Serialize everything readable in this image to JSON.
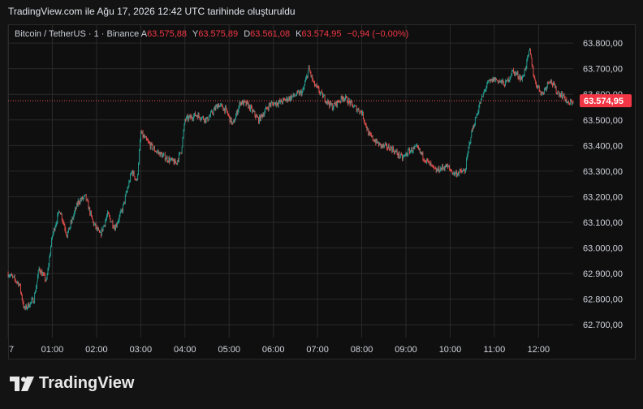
{
  "header": {
    "title": "TradingView.com ile Ağu 17, 2026 12:42 UTC tarihinde oluşturuldu"
  },
  "legend": {
    "symbol": "Bitcoin / TetherUS · 1 · Binance",
    "open_label": "A",
    "open": "63.575,88",
    "high_label": "Y",
    "high": "63.575,89",
    "low_label": "D",
    "low": "63.561,08",
    "close_label": "K",
    "close": "63.574,95",
    "change": "−0,94 (−0,00%)"
  },
  "brand": {
    "name": "TradingView",
    "icon": "tradingview-logo-icon"
  },
  "colors": {
    "up": "#26a69a",
    "down": "#ef5350",
    "grid": "#2a2a2a",
    "price_line": "#ef5350",
    "price_badge": "#f23645",
    "text": "#d1d4dc"
  },
  "chart_data": {
    "type": "candlestick",
    "x_unit": "time (UTC, 2026-08-17)",
    "x_range": [
      "00:00",
      "12:47"
    ],
    "y_range": [
      62650,
      63870
    ],
    "y_ticks": [
      63800,
      63700,
      63600,
      63500,
      63400,
      63300,
      63200,
      63100,
      63000,
      62900,
      62800,
      62700
    ],
    "y_tick_labels": [
      "63.800,00",
      "63.700,00",
      "63.600,00",
      "63.500,00",
      "63.400,00",
      "63.300,00",
      "63.200,00",
      "63.100,00",
      "63.000,00",
      "62.900,00",
      "62.800,00",
      "62.700,00"
    ],
    "x_ticks": [
      "00:00",
      "01:00",
      "02:00",
      "03:00",
      "04:00",
      "05:00",
      "06:00",
      "07:00",
      "08:00",
      "09:00",
      "10:00",
      "11:00",
      "12:00"
    ],
    "x_tick_labels": [
      "7",
      "01:00",
      "02:00",
      "03:00",
      "04:00",
      "05:00",
      "06:00",
      "07:00",
      "08:00",
      "09:00",
      "10:00",
      "11:00",
      "12:00"
    ],
    "last_price": 63574.95,
    "last_price_label": "63.574,95",
    "grid": true,
    "price_path": [
      [
        "00:00",
        62900
      ],
      [
        "00:15",
        62860
      ],
      [
        "00:22",
        62760
      ],
      [
        "00:35",
        62800
      ],
      [
        "00:42",
        62920
      ],
      [
        "00:52",
        62870
      ],
      [
        "01:00",
        63050
      ],
      [
        "01:10",
        63150
      ],
      [
        "01:20",
        63050
      ],
      [
        "01:35",
        63180
      ],
      [
        "01:45",
        63200
      ],
      [
        "01:55",
        63100
      ],
      [
        "02:05",
        63050
      ],
      [
        "02:15",
        63130
      ],
      [
        "02:25",
        63080
      ],
      [
        "02:35",
        63150
      ],
      [
        "02:48",
        63300
      ],
      [
        "02:55",
        63260
      ],
      [
        "03:00",
        63450
      ],
      [
        "03:10",
        63410
      ],
      [
        "03:20",
        63380
      ],
      [
        "03:35",
        63350
      ],
      [
        "03:48",
        63330
      ],
      [
        "03:55",
        63380
      ],
      [
        "04:00",
        63500
      ],
      [
        "04:15",
        63520
      ],
      [
        "04:30",
        63500
      ],
      [
        "04:45",
        63560
      ],
      [
        "04:55",
        63540
      ],
      [
        "05:05",
        63480
      ],
      [
        "05:15",
        63570
      ],
      [
        "05:25",
        63560
      ],
      [
        "05:40",
        63500
      ],
      [
        "05:55",
        63560
      ],
      [
        "06:10",
        63570
      ],
      [
        "06:25",
        63590
      ],
      [
        "06:40",
        63610
      ],
      [
        "06:48",
        63700
      ],
      [
        "06:55",
        63640
      ],
      [
        "07:05",
        63600
      ],
      [
        "07:20",
        63550
      ],
      [
        "07:35",
        63590
      ],
      [
        "07:50",
        63550
      ],
      [
        "08:00",
        63530
      ],
      [
        "08:10",
        63440
      ],
      [
        "08:25",
        63400
      ],
      [
        "08:40",
        63390
      ],
      [
        "08:55",
        63350
      ],
      [
        "09:05",
        63380
      ],
      [
        "09:15",
        63390
      ],
      [
        "09:25",
        63350
      ],
      [
        "09:40",
        63300
      ],
      [
        "09:55",
        63320
      ],
      [
        "10:05",
        63290
      ],
      [
        "10:20",
        63300
      ],
      [
        "10:28",
        63440
      ],
      [
        "10:40",
        63560
      ],
      [
        "10:50",
        63640
      ],
      [
        "11:00",
        63660
      ],
      [
        "11:15",
        63640
      ],
      [
        "11:25",
        63690
      ],
      [
        "11:38",
        63660
      ],
      [
        "11:48",
        63770
      ],
      [
        "11:55",
        63650
      ],
      [
        "12:05",
        63600
      ],
      [
        "12:15",
        63660
      ],
      [
        "12:25",
        63610
      ],
      [
        "12:35",
        63590
      ],
      [
        "12:40",
        63560
      ],
      [
        "12:47",
        63575
      ]
    ]
  }
}
